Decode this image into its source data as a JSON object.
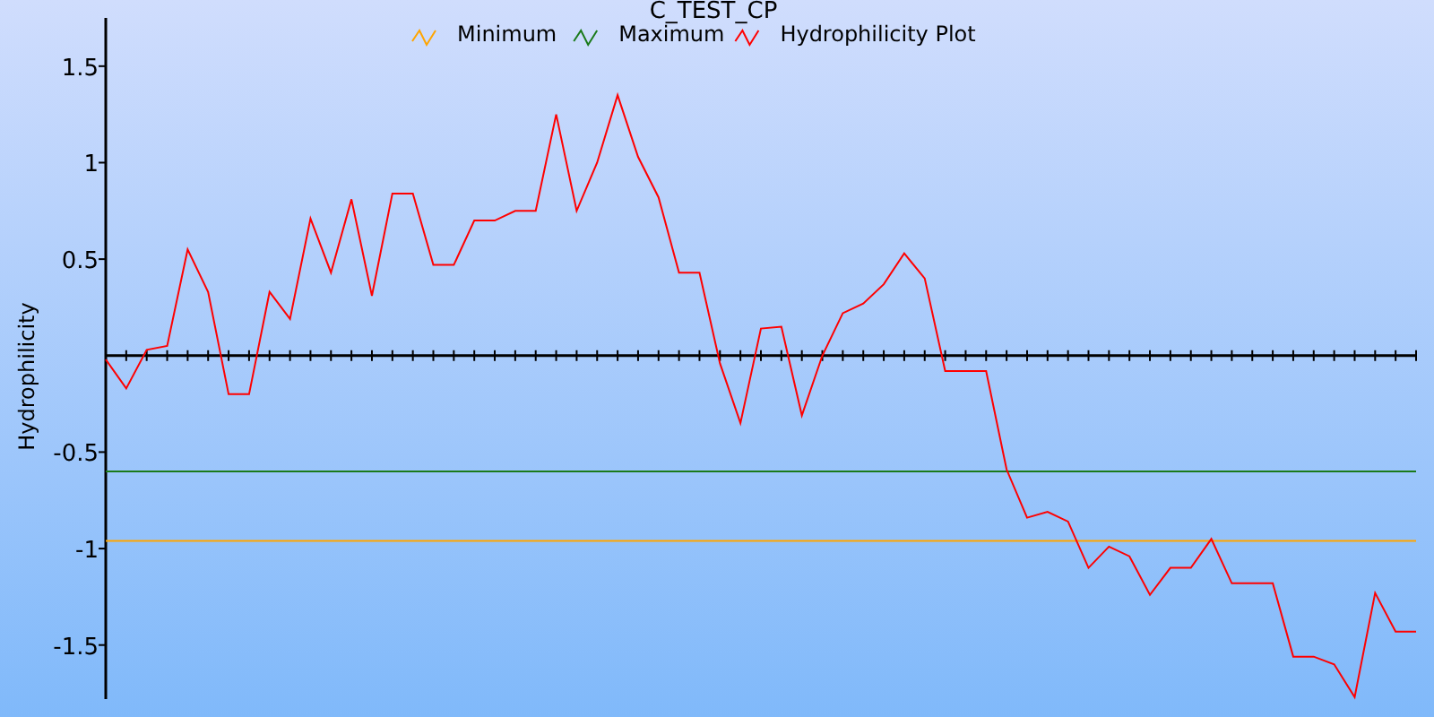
{
  "chart_data": {
    "type": "line",
    "title": "C_TEST_CP",
    "ylabel": "Hydrophilicity",
    "ylim": [
      -1.78,
      1.75
    ],
    "yticks": [
      -1.5,
      -1,
      -0.5,
      0.5,
      1,
      1.5
    ],
    "legend": "top",
    "series": [
      {
        "name": "Minimum",
        "color": "#ffa500",
        "values": [
          -0.96,
          -0.96,
          -0.96,
          -0.96,
          -0.96,
          -0.96,
          -0.96,
          -0.96,
          -0.96,
          -0.96,
          -0.96,
          -0.96,
          -0.96,
          -0.96,
          -0.96,
          -0.96,
          -0.96,
          -0.96,
          -0.96,
          -0.96,
          -0.96,
          -0.96,
          -0.96,
          -0.96,
          -0.96,
          -0.96,
          -0.96,
          -0.96,
          -0.96,
          -0.96,
          -0.96,
          -0.96,
          -0.96,
          -0.96,
          -0.96,
          -0.96,
          -0.96,
          -0.96,
          -0.96,
          -0.96,
          -0.96,
          -0.96,
          -0.96,
          -0.96,
          -0.96,
          -0.96,
          -0.96,
          -0.96,
          -0.96,
          -0.96,
          -0.96,
          -0.96,
          -0.96,
          -0.96,
          -0.96,
          -0.96,
          -0.96,
          -0.96,
          -0.96,
          -0.96,
          -0.96,
          -0.96,
          -0.96,
          -0.96,
          -0.96
        ]
      },
      {
        "name": "Maximum",
        "color": "#1a7a1a",
        "values": [
          -0.6,
          -0.6,
          -0.6,
          -0.6,
          -0.6,
          -0.6,
          -0.6,
          -0.6,
          -0.6,
          -0.6,
          -0.6,
          -0.6,
          -0.6,
          -0.6,
          -0.6,
          -0.6,
          -0.6,
          -0.6,
          -0.6,
          -0.6,
          -0.6,
          -0.6,
          -0.6,
          -0.6,
          -0.6,
          -0.6,
          -0.6,
          -0.6,
          -0.6,
          -0.6,
          -0.6,
          -0.6,
          -0.6,
          -0.6,
          -0.6,
          -0.6,
          -0.6,
          -0.6,
          -0.6,
          -0.6,
          -0.6,
          -0.6,
          -0.6,
          -0.6,
          -0.6,
          -0.6,
          -0.6,
          -0.6,
          -0.6,
          -0.6,
          -0.6,
          -0.6,
          -0.6,
          -0.6,
          -0.6,
          -0.6,
          -0.6,
          -0.6,
          -0.6,
          -0.6,
          -0.6,
          -0.6,
          -0.6,
          -0.6,
          -0.6
        ]
      },
      {
        "name": "Hydrophilicity Plot",
        "color": "#ff0000",
        "values": [
          -0.02,
          -0.17,
          0.03,
          0.05,
          0.55,
          0.33,
          -0.2,
          -0.2,
          0.33,
          0.19,
          0.71,
          0.43,
          0.81,
          0.31,
          0.84,
          0.84,
          0.47,
          0.47,
          0.7,
          0.7,
          0.75,
          0.75,
          1.25,
          0.75,
          1.0,
          1.35,
          1.03,
          0.82,
          0.43,
          0.43,
          -0.04,
          -0.35,
          0.14,
          0.15,
          -0.31,
          0.0,
          0.22,
          0.27,
          0.37,
          0.53,
          0.4,
          -0.08,
          -0.08,
          -0.08,
          -0.59,
          -0.84,
          -0.81,
          -0.86,
          -1.1,
          -0.99,
          -1.04,
          -1.24,
          -1.1,
          -1.1,
          -0.95,
          -1.18,
          -1.18,
          -1.18,
          -1.56,
          -1.56,
          -1.6,
          -1.77,
          -1.23,
          -1.43,
          -1.43
        ]
      }
    ]
  }
}
